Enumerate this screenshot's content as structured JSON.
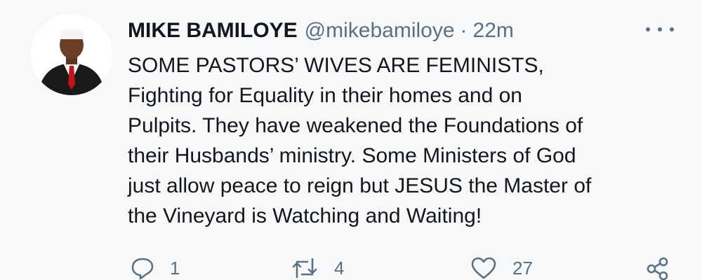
{
  "tweet": {
    "author_name": "MIKE BAMILOYE",
    "handle": "@mikebamiloye",
    "separator": "·",
    "time": "22m",
    "lines": [
      "SOME PASTORS’ WIVES ARE FEMINISTS,",
      "Fighting for Equality in their homes and on",
      "Pulpits. They have weakened the Foundations of",
      "their Husbands’ ministry. Some Ministers of God",
      "just allow peace to reign but JESUS the Master of",
      "the Vineyard is Watching and Waiting!"
    ]
  },
  "actions": {
    "reply": {
      "icon": "reply-icon",
      "count": "1"
    },
    "retweet": {
      "icon": "retweet-icon",
      "count": "4"
    },
    "like": {
      "icon": "heart-icon",
      "count": "27"
    },
    "share": {
      "icon": "share-icon",
      "count": ""
    }
  },
  "colors": {
    "background": "#f7f8f9",
    "text": "#14171a",
    "muted": "#5b7083",
    "tie_red": "#c0141c"
  }
}
